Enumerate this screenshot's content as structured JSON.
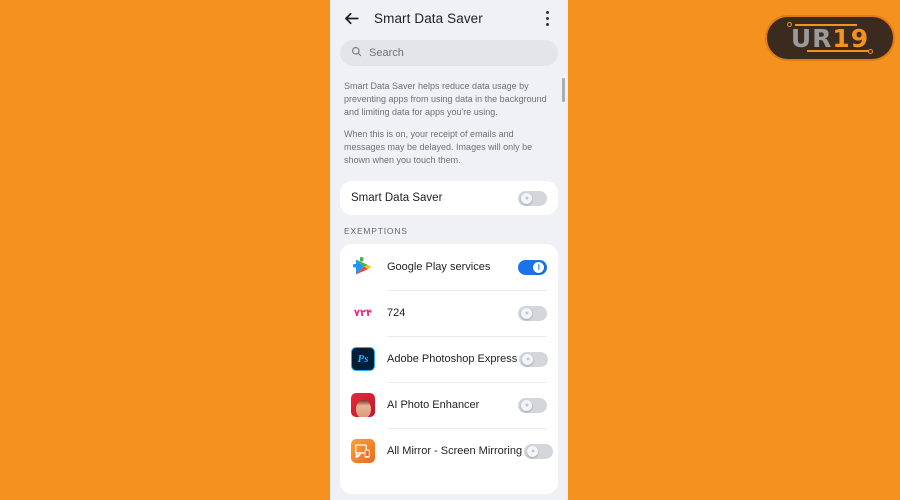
{
  "background": {
    "color": "#F5911F"
  },
  "watermark": {
    "text_main": "UR",
    "text_accent": "19",
    "badge_color": "#3B2B1E",
    "accent_color": "#F5911F"
  },
  "appbar": {
    "back_icon": "back-arrow-icon",
    "title": "Smart Data Saver",
    "menu_icon": "overflow-menu-icon"
  },
  "search": {
    "icon": "search-icon",
    "placeholder": "Search",
    "value": ""
  },
  "description": {
    "paragraph_1": "Smart Data Saver helps reduce data usage by preventing apps from using data in the background and limiting data for apps you're using.",
    "paragraph_2": "When this is on, your receipt of emails and messages may be delayed. Images will only be shown when you touch them."
  },
  "master_setting": {
    "label": "Smart Data Saver",
    "enabled": false
  },
  "exemptions": {
    "header": "EXEMPTIONS",
    "apps": [
      {
        "name": "Google Play services",
        "enabled": true,
        "icon": "google-play-services-icon"
      },
      {
        "name": "724",
        "enabled": false,
        "icon": "app-724-icon"
      },
      {
        "name": "Adobe Photoshop Express",
        "enabled": false,
        "icon": "photoshop-express-icon"
      },
      {
        "name": "AI Photo Enhancer",
        "enabled": false,
        "icon": "ai-photo-enhancer-icon"
      },
      {
        "name": "All Mirror - Screen Mirroring",
        "enabled": false,
        "icon": "all-mirror-icon"
      }
    ]
  },
  "colors": {
    "toggle_on": "#1A73E8",
    "toggle_off": "#D3D6DB",
    "panel_background": "#F0F1F5",
    "card_background": "#FFFFFF"
  },
  "app_724_glyph": "۷۲۴"
}
